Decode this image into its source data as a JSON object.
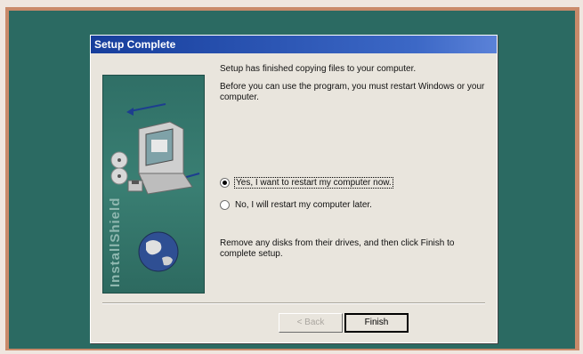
{
  "dialog": {
    "title": "Setup Complete",
    "side_brand": "InstallShield",
    "message_1": "Setup has finished copying files to your computer.",
    "message_2": "Before you can use the program, you must restart Windows or your computer.",
    "options": [
      {
        "label": "Yes, I want to restart my computer now.",
        "selected": true
      },
      {
        "label": "No, I will restart my computer later.",
        "selected": false
      }
    ],
    "message_3": "Remove any disks from their drives, and then click Finish to complete setup.",
    "back_button": "< Back",
    "finish_button": "Finish"
  },
  "icons": [
    "computer-icon",
    "cd-icon",
    "floppy-disk-icon",
    "globe-icon",
    "arrow-icon"
  ],
  "colors": {
    "desktop": "#2b6a62",
    "titlebar": "#173e9c",
    "dialog": "#e9e5dd"
  }
}
